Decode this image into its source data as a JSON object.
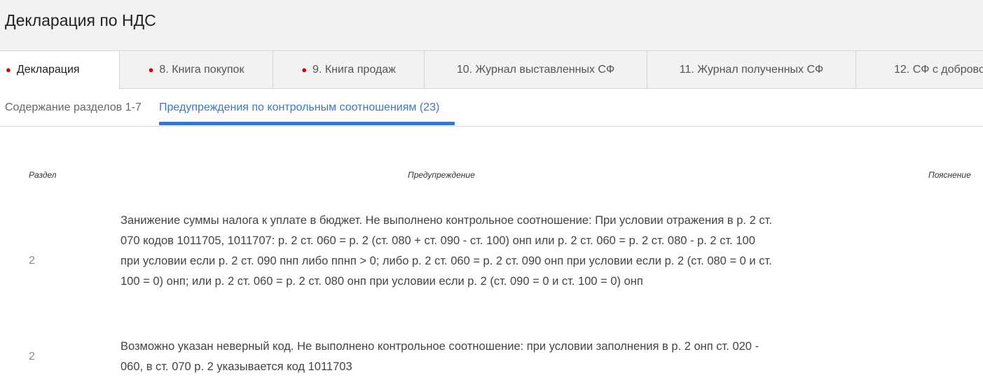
{
  "header": {
    "title": "Декларация по НДС"
  },
  "tabs": [
    {
      "label": "Декларация",
      "marked": true
    },
    {
      "label": "8. Книга покупок",
      "marked": true
    },
    {
      "label": "9. Книга продаж",
      "marked": true
    },
    {
      "label": "10. Журнал выставленных СФ",
      "marked": false
    },
    {
      "label": "11. Журнал полученных СФ",
      "marked": false
    },
    {
      "label": "12. СФ с доброво",
      "marked": false
    }
  ],
  "subtabs": [
    {
      "label": "Содержание разделов 1-7"
    },
    {
      "label": "Предупреждения по контрольным соотношениям (23)"
    }
  ],
  "table": {
    "columns": [
      "Раздел",
      "Предупреждение",
      "Пояснение"
    ],
    "rows": [
      {
        "section": "2",
        "warning": "Занижение суммы налога к уплате в бюджет. Не выполнено контрольное соотношение: При условии отражения в р. 2 ст. 070 кодов 1011705, 1011707: р. 2 ст. 060 = р. 2 (ст. 080 + ст. 090 - ст. 100) онп или р. 2 ст. 060 = р. 2 ст. 080 - р. 2 ст. 100 при условии если р. 2 ст. 090 пнп либо ппнп > 0; либо р. 2 ст. 060 = р. 2 ст. 090 онп при условии если р. 2 (ст. 080 = 0 и ст. 100 = 0) онп; или р. 2 ст. 060 = р. 2 ст. 080 онп при условии если р. 2 (ст. 090 = 0 и ст. 100 = 0) онп"
      },
      {
        "section": "2",
        "warning": "Возможно указан неверный код. Не выполнено контрольное соотношение: при условии заполнения в р. 2 онп ст. 020 - 060, в ст. 070 р. 2 указывается код 1011703"
      }
    ]
  },
  "colors": {
    "accent": "#3a78c3",
    "marker": "#cc0000",
    "header_bg": "#f2f2f2"
  }
}
